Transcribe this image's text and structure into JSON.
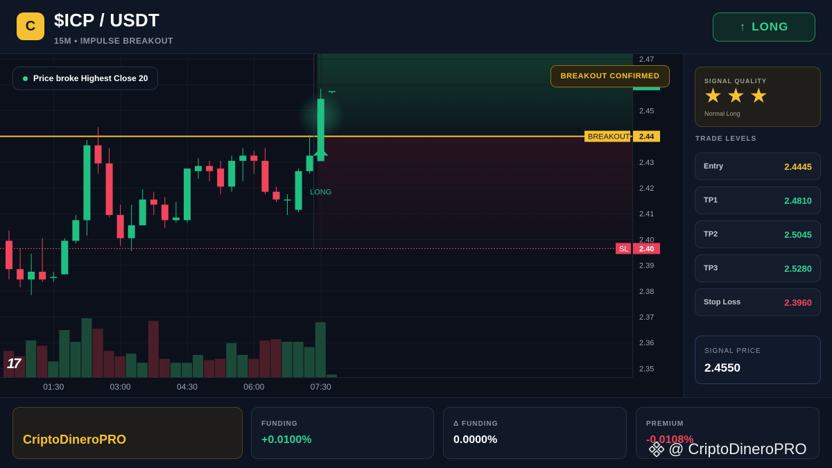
{
  "header": {
    "logo_letter": "C",
    "pair": "$ICP / USDT",
    "subtitle": "15M • IMPULSE BREAKOUT",
    "long_button": {
      "arrow": "↑",
      "label": "LONG"
    }
  },
  "chart_overlay": {
    "condition": "Price broke Highest Close 20",
    "breakout_badge": "BREAKOUT CONFIRMED",
    "breakout_label": "BREAKOUT",
    "sl_label": "SL",
    "long_label": "LONG",
    "tv_logo": "17"
  },
  "colors": {
    "up": "#20c083",
    "down": "#f0455b",
    "accent": "#f5c033",
    "sl": "#e8415a"
  },
  "chart_data": {
    "type": "candlestick",
    "ylim": [
      2.345,
      2.47
    ],
    "y_ticks": [
      "2.47",
      "2.46",
      "2.45",
      "2.44",
      "2.43",
      "2.42",
      "2.41",
      "2.40",
      "2.39",
      "2.38",
      "2.37",
      "2.36",
      "2.35"
    ],
    "x_ticks": [
      "01:30",
      "03:00",
      "04:30",
      "06:00",
      "07:30"
    ],
    "candles": [
      [
        2.3995,
        2.3885,
        2.4035,
        2.3845
      ],
      [
        2.3885,
        2.3845,
        2.3965,
        2.3815
      ],
      [
        2.3845,
        2.3875,
        2.3945,
        2.3785
      ],
      [
        2.3875,
        2.3845,
        2.4005,
        2.3835
      ],
      [
        2.3855,
        2.3855,
        2.3875,
        2.3835
      ],
      [
        2.3865,
        2.3995,
        2.4005,
        2.3865
      ],
      [
        2.3995,
        2.4075,
        2.4095,
        2.3985
      ],
      [
        2.4075,
        2.4365,
        2.4385,
        2.4015
      ],
      [
        2.4365,
        2.4295,
        2.4435,
        2.4255
      ],
      [
        2.4295,
        2.4095,
        2.4355,
        2.4085
      ],
      [
        2.4095,
        2.4005,
        2.4135,
        2.3975
      ],
      [
        2.4005,
        2.4055,
        2.4135,
        2.3955
      ],
      [
        2.4055,
        2.4155,
        2.4195,
        2.4075
      ],
      [
        2.4155,
        2.4135,
        2.4185,
        2.4095
      ],
      [
        2.4135,
        2.4075,
        2.4165,
        2.4045
      ],
      [
        2.4075,
        2.4085,
        2.4145,
        2.4065
      ],
      [
        2.4075,
        2.4275,
        2.4275,
        2.4065
      ],
      [
        2.4265,
        2.4285,
        2.4315,
        2.4235
      ],
      [
        2.4285,
        2.4265,
        2.4305,
        2.4225
      ],
      [
        2.4275,
        2.4205,
        2.4305,
        2.4175
      ],
      [
        2.4205,
        2.4305,
        2.4325,
        2.4185
      ],
      [
        2.4305,
        2.4325,
        2.4355,
        2.4225
      ],
      [
        2.4325,
        2.4305,
        2.4345,
        2.4255
      ],
      [
        2.4305,
        2.4185,
        2.4355,
        2.4175
      ],
      [
        2.4185,
        2.4155,
        2.4205,
        2.4145
      ],
      [
        2.4155,
        2.4155,
        2.4175,
        2.4095
      ],
      [
        2.4115,
        2.4265,
        2.4275,
        2.4105
      ],
      [
        2.4265,
        2.4325,
        2.4405,
        2.4255
      ],
      [
        2.4335,
        2.4545,
        2.4585,
        2.4335
      ],
      [
        2.4575,
        2.4575,
        2.4575,
        2.4565
      ]
    ],
    "volumes": [
      20,
      16,
      28,
      24,
      12,
      36,
      27,
      45,
      37,
      20,
      16,
      18,
      11,
      43,
      14,
      11,
      11,
      17,
      13,
      14,
      26,
      17,
      14,
      28,
      29,
      27,
      27,
      23,
      42,
      2
    ],
    "breakout_level": 2.44,
    "breakout_value": "2.44",
    "sl_value": "2.40",
    "last_price": "2.46"
  },
  "signal_quality": {
    "title": "SIGNAL QUALITY",
    "stars": 3,
    "star_glyph": "★",
    "note": "Normal Long"
  },
  "trade_levels": {
    "title": "TRADE LEVELS",
    "items": [
      {
        "label": "Entry",
        "value": "2.4445",
        "color": "#f5c033"
      },
      {
        "label": "TP1",
        "value": "2.4810",
        "color": "#2ed38f"
      },
      {
        "label": "TP2",
        "value": "2.5045",
        "color": "#2ed38f"
      },
      {
        "label": "TP3",
        "value": "2.5280",
        "color": "#2ed38f"
      },
      {
        "label": "Stop Loss",
        "value": "2.3960",
        "color": "#f0455b"
      }
    ]
  },
  "signal_price": {
    "label": "SIGNAL PRICE",
    "value": "2.4550"
  },
  "footer": {
    "brand": "CriptoDineroPRO",
    "funding": {
      "label": "FUNDING",
      "value": "+0.0100%"
    },
    "delta_funding": {
      "label": "Δ FUNDING",
      "value": "0.0000%"
    },
    "premium": {
      "label": "PREMIUM",
      "value": "-0.0108%"
    },
    "watermark": "@ CriptoDineroPRO"
  }
}
